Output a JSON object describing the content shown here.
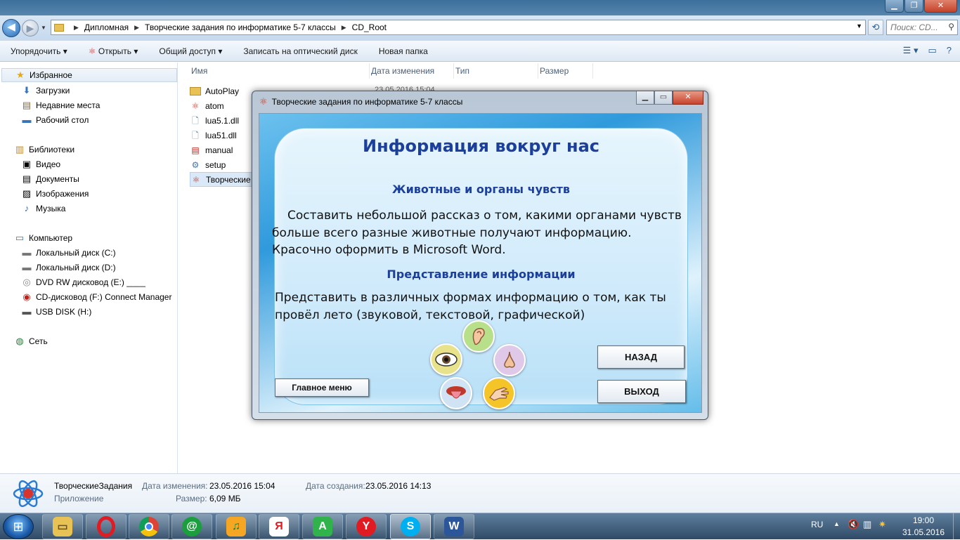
{
  "explorer": {
    "breadcrumb": [
      "Дипломная",
      "Творческие задания по информатике 5-7 классы",
      "CD_Root"
    ],
    "search_placeholder": "Поиск: CD...",
    "toolbar": [
      "Упорядочить ▾",
      "Открыть ▾",
      "Общий доступ ▾",
      "Записать на оптический диск",
      "Новая папка"
    ],
    "nav": {
      "favorites": "Избранное",
      "favorites_items": [
        "Загрузки",
        "Недавние места",
        "Рабочий стол"
      ],
      "libraries": "Библиотеки",
      "libraries_items": [
        "Видео",
        "Документы",
        "Изображения",
        "Музыка"
      ],
      "computer": "Компьютер",
      "computer_items": [
        "Локальный диск (C:)",
        "Локальный диск (D:)",
        "DVD RW дисковод (E:) ____",
        "CD-дисковод (F:) Connect Manager",
        "USB DISK (H:)"
      ],
      "network": "Сеть"
    },
    "columns": [
      "Имя",
      "Дата изменения",
      "Тип",
      "Размер"
    ],
    "files": [
      "AutoPlay",
      "atom",
      "lua5.1.dll",
      "lua51.dll",
      "manual",
      "setup",
      "Творческие"
    ],
    "file_date_visible": "23.05.2016 15:04"
  },
  "details": {
    "name": "ТворческиеЗадания",
    "type": "Приложение",
    "modified_label": "Дата изменения:",
    "modified_value": "23.05.2016 15:04",
    "created_label": "Дата создания:",
    "created_value": "23.05.2016 14:13",
    "size_label": "Размер:",
    "size_value": "6,09 МБ"
  },
  "dialog": {
    "title": "Творческие задания по информатике 5-7 классы",
    "heading": "Информация вокруг нас",
    "section1_title": "Животные и органы чувств",
    "section1_text": "Составить небольшой рассказ о том, какими органами чувств больше всего разные животные получают информацию. Красочно оформить в Microsoft Word.",
    "section2_title": "Представление информации",
    "section2_text": "Представить в различных формах информацию о том, как ты провёл лето (звуковой, текстовой, графической)",
    "back_button": "НАЗАД",
    "exit_button": "ВЫХОД",
    "main_menu_button": "Главное меню"
  },
  "taskbar": {
    "lang": "RU",
    "time": "19:00",
    "date": "31.05.2016",
    "apps": [
      "explorer-icon",
      "opera-icon",
      "chrome-icon",
      "mail-agent-icon",
      "music-icon",
      "yandex-icon",
      "a-icon",
      "yandex-browser-icon",
      "skype-icon",
      "word-icon"
    ]
  },
  "colors": {
    "heading": "#1b3f9a",
    "taskbar": "#2f4a66",
    "explorer_chrome": "#c5d9ee"
  }
}
